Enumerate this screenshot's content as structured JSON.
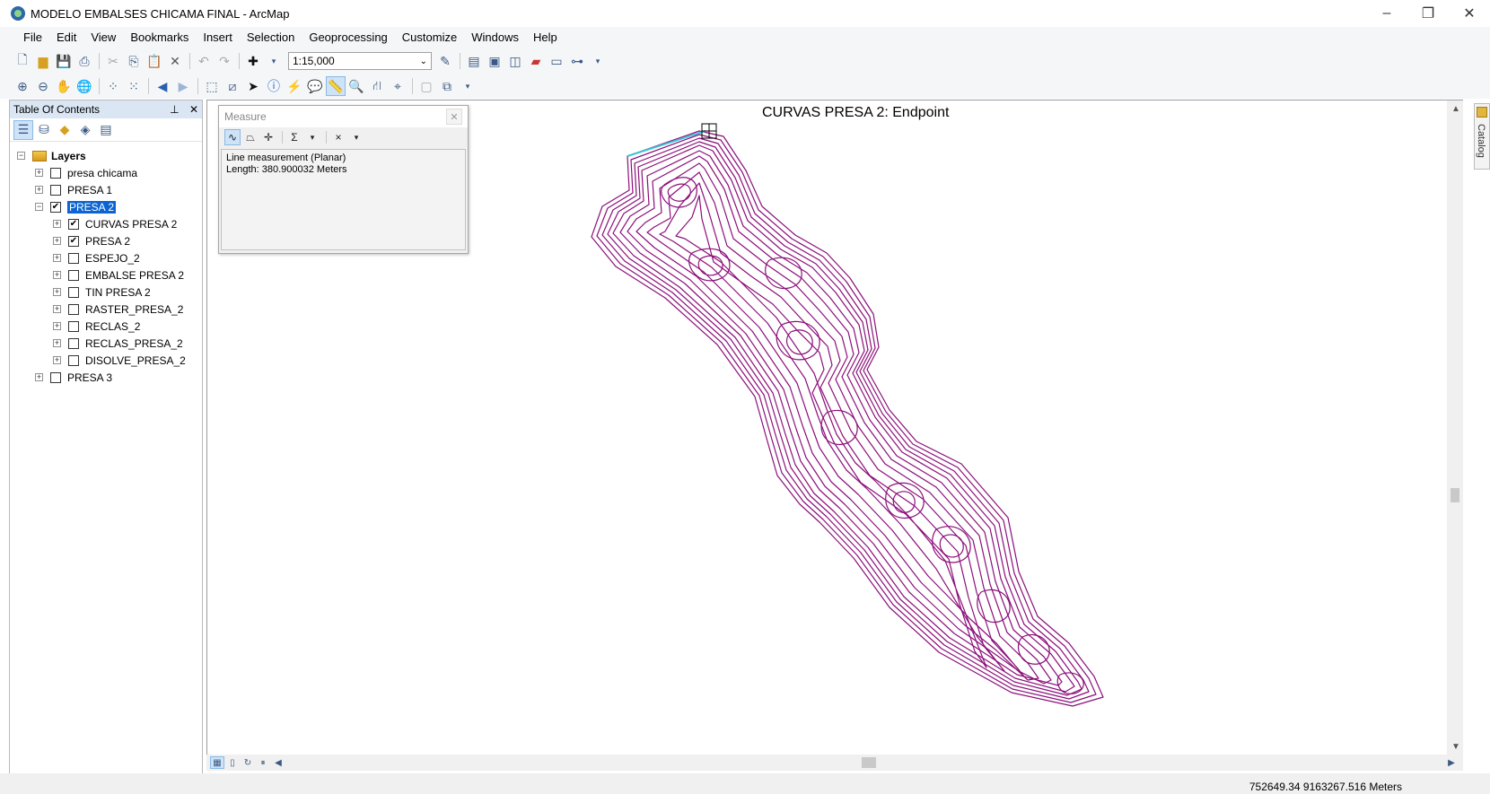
{
  "window": {
    "title": "MODELO EMBALSES CHICAMA FINAL - ArcMap",
    "min": "–",
    "restore": "❐",
    "close": "✕"
  },
  "menu": [
    "File",
    "Edit",
    "View",
    "Bookmarks",
    "Insert",
    "Selection",
    "Geoprocessing",
    "Customize",
    "Windows",
    "Help"
  ],
  "toolbar": {
    "scale": "1:15,000"
  },
  "toc": {
    "title": "Table Of Contents",
    "pin": "⊥",
    "close": "✕",
    "root": "Layers",
    "items": [
      {
        "label": "presa chicama",
        "checked": false,
        "level": 1,
        "expander": "+"
      },
      {
        "label": "PRESA 1",
        "checked": false,
        "level": 1,
        "expander": "+"
      },
      {
        "label": "PRESA 2",
        "checked": true,
        "level": 1,
        "expander": "−",
        "selected": true
      },
      {
        "label": "CURVAS PRESA 2",
        "checked": true,
        "level": 2,
        "expander": "+"
      },
      {
        "label": "PRESA 2",
        "checked": true,
        "level": 2,
        "expander": "+"
      },
      {
        "label": "ESPEJO_2",
        "checked": false,
        "level": 2,
        "expander": "+"
      },
      {
        "label": "EMBALSE PRESA 2",
        "checked": false,
        "level": 2,
        "expander": "+"
      },
      {
        "label": "TIN PRESA 2",
        "checked": false,
        "level": 2,
        "expander": "+"
      },
      {
        "label": "RASTER_PRESA_2",
        "checked": false,
        "level": 2,
        "expander": "+"
      },
      {
        "label": "RECLAS_2",
        "checked": false,
        "level": 2,
        "expander": "+"
      },
      {
        "label": "RECLAS_PRESA_2",
        "checked": false,
        "level": 2,
        "expander": "+"
      },
      {
        "label": "DISOLVE_PRESA_2",
        "checked": false,
        "level": 2,
        "expander": "+"
      },
      {
        "label": "PRESA 3",
        "checked": false,
        "level": 1,
        "expander": "+"
      }
    ]
  },
  "map": {
    "snap_label": "CURVAS PRESA 2: Endpoint",
    "contour_color": "#8b0f7a",
    "measure_line_color": "#3cc3d6"
  },
  "measure": {
    "title": "Measure",
    "close": "✕",
    "line1": "Line measurement (Planar)",
    "line2": "Length: 380.900032 Meters"
  },
  "status": {
    "coords": "752649.34  9163267.516 Meters"
  },
  "catalog": {
    "label": "Catalog"
  }
}
